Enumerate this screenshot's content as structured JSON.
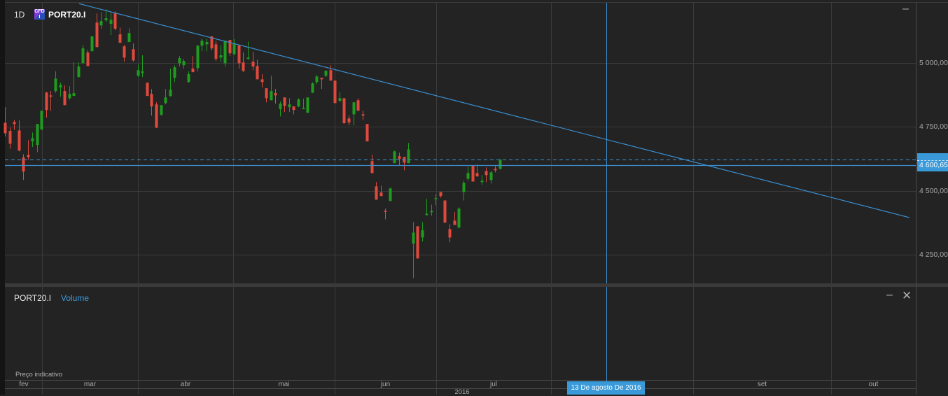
{
  "header": {
    "timeframe": "1D",
    "badge_icon": "cfd-icon",
    "symbol": "PORT20.I",
    "minimize_icon": "minimize-icon"
  },
  "volume_pane": {
    "symbol": "PORT20.I",
    "indicator": "Volume",
    "note": "Preço indicativo",
    "minimize_icon": "minimize-icon",
    "close_icon": "close-icon"
  },
  "price_axis": {
    "ticks": [
      "5 000,00",
      "4 750,00",
      "4 500,00",
      "4 250,00"
    ],
    "current_label": "4 600,65"
  },
  "time_axis": {
    "months": [
      "fev",
      "mar",
      "abr",
      "mai",
      "jun",
      "jul",
      "set",
      "out"
    ],
    "year": "2016",
    "crosshair_label": "13 De agosto De 2016"
  },
  "colors": {
    "background": "#232323",
    "grid": "#3b3b3b",
    "up": "#1f9c1f",
    "down": "#e04a3c",
    "line": "#3a8fd0",
    "label_bg": "#3a9ad9"
  },
  "chart_data": {
    "type": "candlestick",
    "symbol": "PORT20.I",
    "interval": "1D",
    "ylim": [
      4170,
      5250
    ],
    "yticks": [
      4250,
      4500,
      4750,
      5000
    ],
    "grid": true,
    "horizontal_line": 4600.65,
    "last_price_dashed": 4621,
    "trendline": [
      [
        "2016-03-13",
        5232
      ],
      [
        "2016-10-18",
        4395
      ]
    ],
    "crosshair_date": "2016-08-13",
    "candles_fields": [
      "date",
      "open",
      "high",
      "low",
      "close"
    ],
    "candles": [
      [
        "2016-02-18",
        4766,
        4827,
        4712,
        4725
      ],
      [
        "2016-02-19",
        4734,
        4747,
        4665,
        4684
      ],
      [
        "2016-02-22",
        4769,
        4777,
        4739,
        4761
      ],
      [
        "2016-02-23",
        4736,
        4775,
        4654,
        4657
      ],
      [
        "2016-02-24",
        4630,
        4643,
        4542,
        4575
      ],
      [
        "2016-02-25",
        4640,
        4698,
        4621,
        4632
      ],
      [
        "2016-02-26",
        4693,
        4728,
        4671,
        4706
      ],
      [
        "2016-02-29",
        4679,
        4761,
        4651,
        4761
      ],
      [
        "2016-03-01",
        4739,
        4813,
        4739,
        4813
      ],
      [
        "2016-03-02",
        4884,
        4887,
        4786,
        4816
      ],
      [
        "2016-03-03",
        4873,
        4890,
        4813,
        4868
      ],
      [
        "2016-03-04",
        4890,
        4967,
        4884,
        4939
      ],
      [
        "2016-03-07",
        4904,
        4923,
        4868,
        4914
      ],
      [
        "2016-03-08",
        4890,
        4912,
        4835,
        4835
      ],
      [
        "2016-03-09",
        4862,
        4909,
        4857,
        4879
      ],
      [
        "2016-03-10",
        4871,
        5002,
        4871,
        4882
      ],
      [
        "2016-03-11",
        4945,
        5002,
        4942,
        4986
      ],
      [
        "2016-03-14",
        4999,
        5071,
        4999,
        5057
      ],
      [
        "2016-03-15",
        5041,
        5051,
        4988,
        4988
      ],
      [
        "2016-03-16",
        5046,
        5104,
        5046,
        5104
      ],
      [
        "2016-03-17",
        5158,
        5194,
        5062,
        5062
      ],
      [
        "2016-03-18",
        5147,
        5199,
        5134,
        5164
      ],
      [
        "2016-03-21",
        5167,
        5210,
        5161,
        5175
      ],
      [
        "2016-03-22",
        5153,
        5197,
        5109,
        5169
      ],
      [
        "2016-03-23",
        5194,
        5202,
        5128,
        5134
      ],
      [
        "2016-03-24",
        5112,
        5139,
        5079,
        5079
      ],
      [
        "2016-03-28",
        5065,
        5071,
        5005,
        5021
      ],
      [
        "2016-03-29",
        5082,
        5136,
        5082,
        5117
      ],
      [
        "2016-03-30",
        5054,
        5076,
        5005,
        5010
      ],
      [
        "2016-03-31",
        4950,
        4994,
        4945,
        4972
      ],
      [
        "2016-04-01",
        4961,
        5030,
        4945,
        4967
      ],
      [
        "2016-04-04",
        4923,
        4923,
        4871,
        4871
      ],
      [
        "2016-04-05",
        4879,
        4898,
        4794,
        4830
      ],
      [
        "2016-04-06",
        4838,
        4846,
        4745,
        4747
      ],
      [
        "2016-04-07",
        4797,
        4835,
        4794,
        4835
      ],
      [
        "2016-04-08",
        4843,
        4898,
        4838,
        4865
      ],
      [
        "2016-04-11",
        4871,
        4978,
        4868,
        4895
      ],
      [
        "2016-04-12",
        4942,
        4991,
        4925,
        4983
      ],
      [
        "2016-04-13",
        4999,
        5027,
        4986,
        5019
      ],
      [
        "2016-04-14",
        4991,
        5016,
        4978,
        5008
      ],
      [
        "2016-04-15",
        4925,
        4967,
        4923,
        4956
      ],
      [
        "2016-04-18",
        4978,
        5027,
        4964,
        4964
      ],
      [
        "2016-04-19",
        4980,
        5068,
        4967,
        5068
      ],
      [
        "2016-04-20",
        5068,
        5095,
        5046,
        5087
      ],
      [
        "2016-04-21",
        5073,
        5095,
        5046,
        5082
      ],
      [
        "2016-04-22",
        5104,
        5104,
        5049,
        5057
      ],
      [
        "2016-04-25",
        5073,
        5087,
        5008,
        5016
      ],
      [
        "2016-04-26",
        5021,
        5068,
        5005,
        5030
      ],
      [
        "2016-04-27",
        4999,
        5087,
        4986,
        5087
      ],
      [
        "2016-04-28",
        5090,
        5090,
        5027,
        5038
      ],
      [
        "2016-04-29",
        5035,
        5093,
        5030,
        5076
      ],
      [
        "2016-05-02",
        5068,
        5068,
        4978,
        4999
      ],
      [
        "2016-05-03",
        5002,
        5041,
        4964,
        4969
      ],
      [
        "2016-05-04",
        5016,
        5084,
        5013,
        5021
      ],
      [
        "2016-05-05",
        5005,
        5043,
        4972,
        4986
      ],
      [
        "2016-05-06",
        4988,
        5013,
        4936,
        4936
      ],
      [
        "2016-05-09",
        4936,
        4956,
        4904,
        4925
      ],
      [
        "2016-05-10",
        4901,
        4901,
        4846,
        4862
      ],
      [
        "2016-05-11",
        4854,
        4950,
        4854,
        4890
      ],
      [
        "2016-05-12",
        4882,
        4898,
        4841,
        4873
      ],
      [
        "2016-05-13",
        4819,
        4849,
        4791,
        4841
      ],
      [
        "2016-05-16",
        4865,
        4865,
        4808,
        4832
      ],
      [
        "2016-05-17",
        4827,
        4862,
        4808,
        4838
      ],
      [
        "2016-05-18",
        4830,
        4830,
        4799,
        4816
      ],
      [
        "2016-05-19",
        4830,
        4862,
        4827,
        4857
      ],
      [
        "2016-05-20",
        4819,
        4860,
        4819,
        4824
      ],
      [
        "2016-05-23",
        4805,
        4865,
        4805,
        4865
      ],
      [
        "2016-05-24",
        4884,
        4925,
        4882,
        4920
      ],
      [
        "2016-05-25",
        4925,
        4953,
        4917,
        4947
      ],
      [
        "2016-05-26",
        4942,
        4942,
        4898,
        4936
      ],
      [
        "2016-05-27",
        4950,
        4972,
        4945,
        4969
      ],
      [
        "2016-05-30",
        4972,
        4991,
        4931,
        4931
      ],
      [
        "2016-05-31",
        4931,
        4931,
        4843,
        4843
      ],
      [
        "2016-06-01",
        4851,
        4887,
        4851,
        4862
      ],
      [
        "2016-06-02",
        4862,
        4862,
        4764,
        4764
      ],
      [
        "2016-06-03",
        4783,
        4794,
        4756,
        4767
      ],
      [
        "2016-06-06",
        4799,
        4846,
        4756,
        4846
      ],
      [
        "2016-06-07",
        4854,
        4862,
        4813,
        4813
      ],
      [
        "2016-06-08",
        4799,
        4813,
        4777,
        4794
      ],
      [
        "2016-06-09",
        4761,
        4761,
        4693,
        4693
      ],
      [
        "2016-06-10",
        4616,
        4641,
        4569,
        4569
      ],
      [
        "2016-06-13",
        4517,
        4534,
        4465,
        4465
      ],
      [
        "2016-06-14",
        4493,
        4520,
        4479,
        4479
      ],
      [
        "2016-06-15",
        4421,
        4430,
        4388,
        4419
      ],
      [
        "2016-06-16",
        4460,
        4512,
        4460,
        4509
      ],
      [
        "2016-06-17",
        4608,
        4657,
        4608,
        4654
      ],
      [
        "2016-06-20",
        4635,
        4649,
        4599,
        4624
      ],
      [
        "2016-06-21",
        4632,
        4632,
        4580,
        4610
      ],
      [
        "2016-06-22",
        4608,
        4687,
        4608,
        4662
      ],
      [
        "2016-06-23",
        4293,
        4377,
        4158,
        4336
      ],
      [
        "2016-06-24",
        4361,
        4361,
        4235,
        4235
      ],
      [
        "2016-06-27",
        4317,
        4377,
        4301,
        4345
      ],
      [
        "2016-06-28",
        4405,
        4468,
        4402,
        4410
      ],
      [
        "2016-06-29",
        4416,
        4446,
        4402,
        4421
      ],
      [
        "2016-06-30",
        4468,
        4487,
        4443,
        4471
      ],
      [
        "2016-07-01",
        4495,
        4495,
        4473,
        4479
      ],
      [
        "2016-07-04",
        4462,
        4462,
        4375,
        4375
      ],
      [
        "2016-07-05",
        4350,
        4369,
        4298,
        4317
      ],
      [
        "2016-07-06",
        4383,
        4416,
        4366,
        4366
      ],
      [
        "2016-07-07",
        4356,
        4435,
        4353,
        4430
      ],
      [
        "2016-07-08",
        4495,
        4539,
        4462,
        4531
      ],
      [
        "2016-07-11",
        4547,
        4594,
        4539,
        4569
      ],
      [
        "2016-07-12",
        4597,
        4597,
        4536,
        4536
      ],
      [
        "2016-07-13",
        4569,
        4602,
        4556,
        4556
      ],
      [
        "2016-07-14",
        4534,
        4561,
        4523,
        4539
      ],
      [
        "2016-07-15",
        4577,
        4591,
        4534,
        4561
      ],
      [
        "2016-07-18",
        4542,
        4577,
        4528,
        4572
      ],
      [
        "2016-07-19",
        4586,
        4599,
        4572,
        4580
      ],
      [
        "2016-07-20",
        4586,
        4624,
        4583,
        4621
      ]
    ]
  }
}
